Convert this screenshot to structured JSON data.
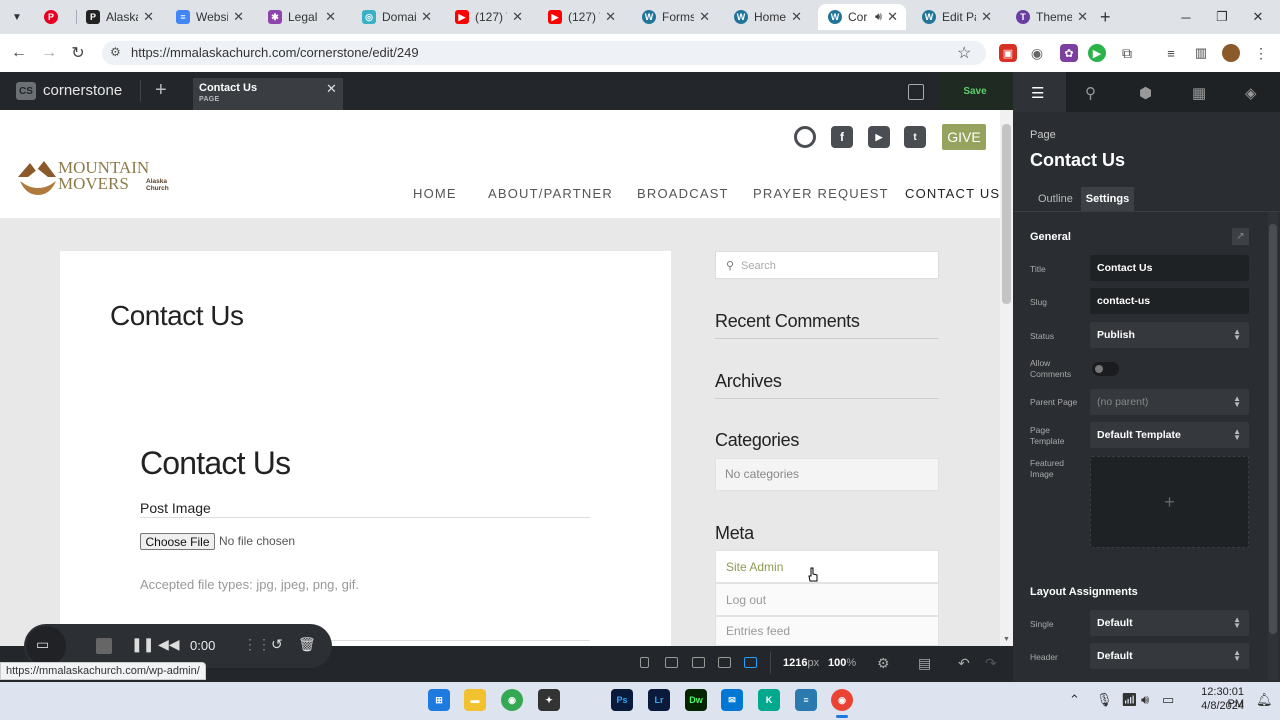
{
  "browser": {
    "tabs": [
      {
        "label": "",
        "icon": "pinterest-icon",
        "color": "#e60023"
      },
      {
        "label": "Alaska C",
        "icon": "p-icon",
        "color": "#222"
      },
      {
        "label": "Website",
        "icon": "docs-icon",
        "color": "#4285f4"
      },
      {
        "label": "Legal A",
        "icon": "star-icon",
        "color": "#8e44ad"
      },
      {
        "label": "Domain",
        "icon": "globe-icon",
        "color": "#3ab0c4"
      },
      {
        "label": "(127) Tr",
        "icon": "youtube-icon",
        "color": "#ff0000"
      },
      {
        "label": "(127) Tr",
        "icon": "youtube-icon",
        "color": "#ff0000"
      },
      {
        "label": "Forms -",
        "icon": "wordpress-icon",
        "color": "#21759b"
      },
      {
        "label": "Home -",
        "icon": "wordpress-icon",
        "color": "#21759b"
      },
      {
        "label": "Cor",
        "icon": "wordpress-icon",
        "color": "#21759b"
      },
      {
        "label": "Edit Pa",
        "icon": "wordpress-icon",
        "color": "#21759b"
      },
      {
        "label": "Theme",
        "icon": "theme-icon",
        "color": "#6a3ea1"
      }
    ],
    "url": "https://mmalaskachurch.com/cornerstone/edit/249",
    "status_url": "https://mmalaskachurch.com/wp-admin/"
  },
  "cornerstone": {
    "brand": "cornerstone",
    "logo_text": "CS",
    "doc_tab": {
      "title": "Contact Us",
      "subtitle": "PAGE"
    },
    "save_label": "Save",
    "viewport_width": "1216",
    "viewport_unit": "px",
    "zoom": "100",
    "zoom_unit": "%"
  },
  "site": {
    "logo_text": "MOUNTAIN MOVERS",
    "logo_subtext": "Alaska Church",
    "give_label": "GIVE",
    "nav": [
      "HOME",
      "ABOUT/PARTNER",
      "BROADCAST",
      "PRAYER REQUEST",
      "CONTACT US"
    ],
    "page_title": "Contact Us",
    "form_title": "Contact Us",
    "post_image_label": "Post Image",
    "choose_file_label": "Choose File",
    "no_file_label": "No file chosen",
    "accepted_types": "Accepted file types: jpg, jpeg, png, gif.",
    "search_placeholder": "Search",
    "widgets": {
      "recent_comments": "Recent Comments",
      "archives": "Archives",
      "categories": "Categories",
      "no_categories": "No categories",
      "meta": "Meta",
      "meta_links": [
        "Site Admin",
        "Log out",
        "Entries feed"
      ]
    }
  },
  "recorder": {
    "time": "0:00"
  },
  "panel": {
    "kind_label": "Page",
    "title": "Contact Us",
    "tabs": [
      "Outline",
      "Settings"
    ],
    "general_label": "General",
    "fields": {
      "title": {
        "label": "Title",
        "value": "Contact Us"
      },
      "slug": {
        "label": "Slug",
        "value": "contact-us"
      },
      "status": {
        "label": "Status",
        "value": "Publish"
      },
      "allow_comments": {
        "label": "Allow Comments"
      },
      "parent_page": {
        "label": "Parent Page",
        "value": "(no parent)"
      },
      "page_template": {
        "label": "Page Template",
        "value": "Default Template"
      },
      "featured_image": {
        "label": "Featured Image"
      }
    },
    "layout_label": "Layout Assignments",
    "single": {
      "label": "Single",
      "value": "Default"
    },
    "header": {
      "label": "Header",
      "value": "Default"
    }
  },
  "taskbar": {
    "time": "12:30:01 PM",
    "date": "4/8/2024",
    "apps": [
      "Ps",
      "Lr",
      "Dw"
    ]
  },
  "colors": {
    "give_green": "#95a35e",
    "save_green": "#5fcf6a",
    "link_olive": "#8c9a52"
  }
}
